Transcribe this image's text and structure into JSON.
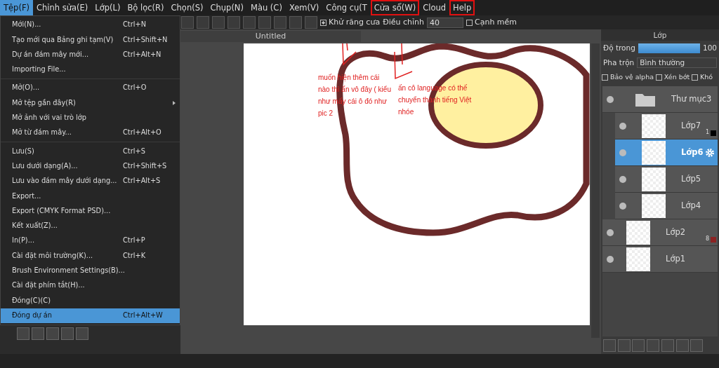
{
  "menubar": [
    {
      "label": "Tệp(F)",
      "selected": true,
      "annotated": false
    },
    {
      "label": "Chỉnh sửa(E)",
      "selected": false,
      "annotated": false
    },
    {
      "label": "Lớp(L)",
      "selected": false,
      "annotated": false
    },
    {
      "label": "Bộ lọc(R)",
      "selected": false,
      "annotated": false
    },
    {
      "label": "Chọn(S)",
      "selected": false,
      "annotated": false
    },
    {
      "label": "Chụp(N)",
      "selected": false,
      "annotated": false
    },
    {
      "label": "Màu (C)",
      "selected": false,
      "annotated": false
    },
    {
      "label": "Xem(V)",
      "selected": false,
      "annotated": false
    },
    {
      "label": "Công cụ(T",
      "selected": false,
      "annotated": false
    },
    {
      "label": "Cửa sổ(W)",
      "selected": false,
      "annotated": true
    },
    {
      "label": "Cloud",
      "selected": false,
      "annotated": false
    },
    {
      "label": "Help",
      "selected": false,
      "annotated": true
    }
  ],
  "toolbar": {
    "antialias": {
      "label": "Khử răng cưa",
      "checked": true
    },
    "adjust": {
      "label": "Điều chỉnh",
      "value": "40"
    },
    "soft_edge": {
      "label": "Cạnh mềm",
      "checked": false
    }
  },
  "file_menu": [
    {
      "label": "Mới(N)...",
      "shortcut": "Ctrl+N",
      "selected": false
    },
    {
      "label": "Tạo mới qua Bảng ghi tạm(V)",
      "shortcut": "Ctrl+Shift+N",
      "selected": false
    },
    {
      "label": "Dự án đám mây mới...",
      "shortcut": "Ctrl+Alt+N",
      "selected": false
    },
    {
      "label": "Importing File...",
      "selected": false,
      "separator_after": true
    },
    {
      "label": "Mở(O)...",
      "shortcut": "Ctrl+O",
      "selected": false
    },
    {
      "label": "Mở tệp gần đây(R)",
      "submenu": true,
      "selected": false
    },
    {
      "label": "Mở ảnh với vai trò lớp",
      "selected": false
    },
    {
      "label": "Mở từ đám mây...",
      "shortcut": "Ctrl+Alt+O",
      "selected": false,
      "separator_after": true
    },
    {
      "label": "Lưu(S)",
      "shortcut": "Ctrl+S",
      "selected": false
    },
    {
      "label": "Lưu dưới dạng(A)...",
      "shortcut": "Ctrl+Shift+S",
      "selected": false
    },
    {
      "label": "Lưu vào đám mây dưới dạng...",
      "shortcut": "Ctrl+Alt+S",
      "selected": false
    },
    {
      "label": "Export...",
      "selected": false
    },
    {
      "label": "Export (CMYK Format PSD)...",
      "selected": false
    },
    {
      "label": "Kết xuất(Z)...",
      "selected": false
    },
    {
      "label": "In(P)...",
      "shortcut": "Ctrl+P",
      "selected": false
    },
    {
      "label": "Cài đặt môi trường(K)...",
      "shortcut": "Ctrl+K",
      "selected": false
    },
    {
      "label": "Brush Environment Settings(B)...",
      "selected": false
    },
    {
      "label": "Cài đặt phím tắt(H)...",
      "selected": false
    },
    {
      "label": "Đóng(C)(C)",
      "selected": false
    },
    {
      "label": "Đóng dự án",
      "shortcut": "Ctrl+Alt+W",
      "selected": true
    }
  ],
  "document_tab": {
    "title": "Untitled"
  },
  "annotations": [
    "muốn hiện thêm cái nào thì ấn vô đây ( kiểu như mấy cái ô đó như pic 2",
    "ấn cô language có thế chuyển thành tiếng Việt nhóe"
  ],
  "layer_panel": {
    "title": "Lớp",
    "opacity": {
      "label": "Độ trong",
      "level": 1.0,
      "reading": "100"
    },
    "blend": {
      "label": "Pha trộn",
      "value": "Bình thường"
    },
    "options": [
      {
        "label": "Bảo vệ alpha",
        "checked": false
      },
      {
        "label": "Xén bớt",
        "checked": false
      },
      {
        "label": "Khó",
        "checked": false
      }
    ],
    "layers": [
      {
        "kind": "folder",
        "name": "Thư mục3",
        "selected": false,
        "children": [
          {
            "kind": "layer",
            "name": "Lớp7",
            "selected": false,
            "badge": "1",
            "color": "#000000"
          },
          {
            "kind": "layer",
            "name": "Lớp6",
            "selected": true
          },
          {
            "kind": "layer",
            "name": "Lớp5",
            "selected": false
          },
          {
            "kind": "layer",
            "name": "Lớp4",
            "selected": false
          }
        ]
      },
      {
        "kind": "layer",
        "name": "Lớp2",
        "selected": false,
        "badge": "8",
        "color": "#8b2323"
      },
      {
        "kind": "layer",
        "name": "Lớp1",
        "selected": false
      }
    ]
  }
}
